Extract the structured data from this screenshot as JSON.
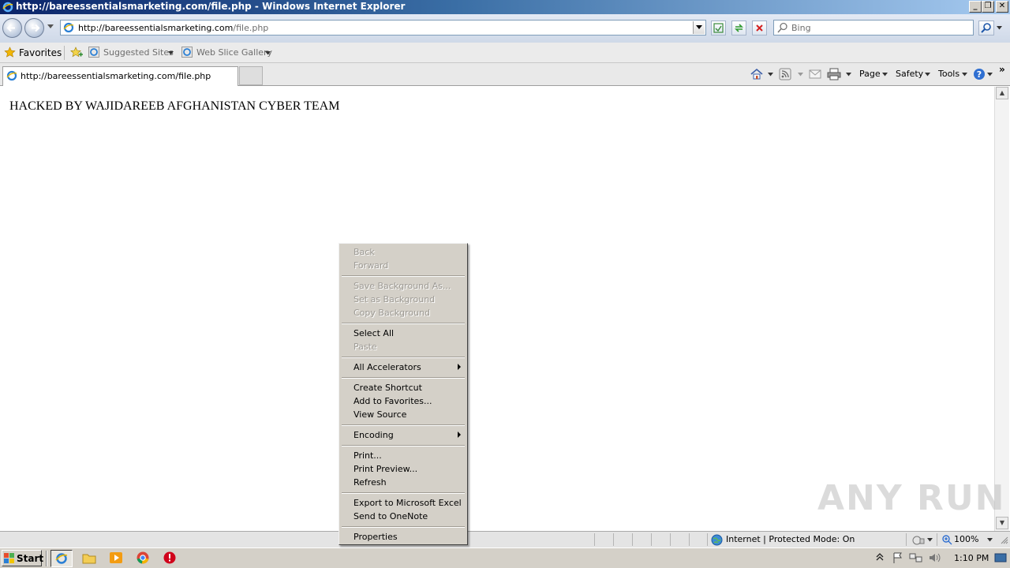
{
  "window": {
    "title": "http://bareessentialsmarketing.com/file.php - Windows Internet Explorer",
    "min_label": "_",
    "max_label": "❐",
    "close_label": "✕"
  },
  "address_bar": {
    "url_domain": "http://bareessentialsmarketing.com",
    "url_path": "/file.php"
  },
  "search": {
    "placeholder": "Bing"
  },
  "favorites_bar": {
    "favorites_label": "Favorites",
    "suggested_sites_label": "Suggested Sites",
    "web_slice_label": "Web Slice Gallery"
  },
  "tab": {
    "label": "http://bareessentialsmarketing.com/file.php"
  },
  "command_bar": {
    "page_label": "Page",
    "safety_label": "Safety",
    "tools_label": "Tools",
    "overflow_label": "»"
  },
  "page": {
    "text": "HACKED BY WAJIDAREEB AFGHANISTAN CYBER TEAM"
  },
  "status_bar": {
    "zone": "Internet | Protected Mode: On",
    "zoom": "100%"
  },
  "taskbar": {
    "start_label": "Start",
    "clock": "1:10 PM"
  },
  "context_menu": {
    "back": "Back",
    "forward": "Forward",
    "save_background_as": "Save Background As...",
    "set_as_background": "Set as Background",
    "copy_background": "Copy Background",
    "select_all": "Select All",
    "paste": "Paste",
    "all_accelerators": "All Accelerators",
    "create_shortcut": "Create Shortcut",
    "add_to_favorites": "Add to Favorites...",
    "view_source": "View Source",
    "encoding": "Encoding",
    "print": "Print...",
    "print_preview": "Print Preview...",
    "refresh": "Refresh",
    "export_excel": "Export to Microsoft Excel",
    "send_onenote": "Send to OneNote",
    "properties": "Properties"
  },
  "watermark": "ANY RUN",
  "colors": {
    "title_gradient_start": "#0a246a",
    "menu_bg": "#d4d0c8",
    "disabled_text": "#9d9a94"
  }
}
